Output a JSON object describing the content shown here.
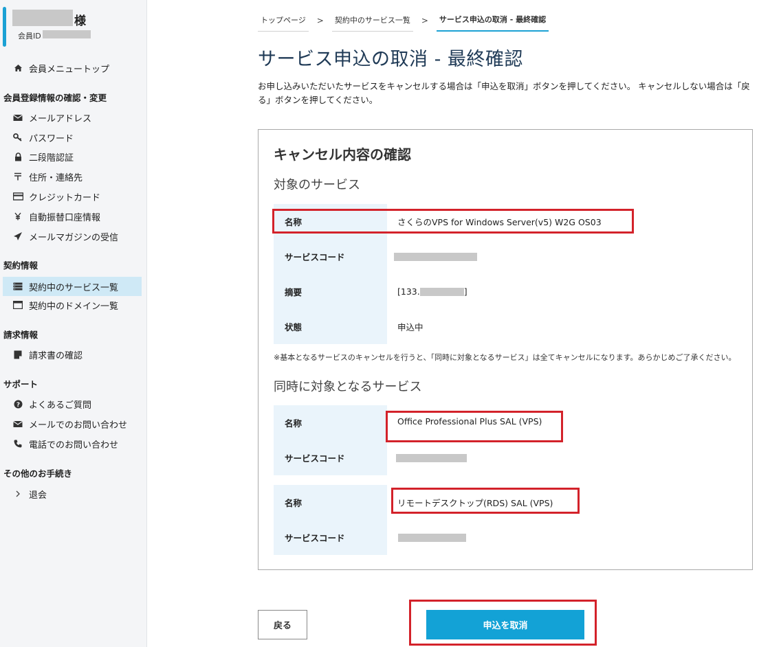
{
  "user": {
    "honorific": "様",
    "member_id_label": "会員ID"
  },
  "sidebar": {
    "top_item": "会員メニュートップ",
    "sections": [
      {
        "heading": "会員登録情報の確認・変更",
        "items": [
          "メールアドレス",
          "パスワード",
          "二段階認証",
          "住所・連絡先",
          "クレジットカード",
          "自動振替口座情報",
          "メールマガジンの受信"
        ]
      },
      {
        "heading": "契約情報",
        "items": [
          "契約中のサービス一覧",
          "契約中のドメイン一覧"
        ]
      },
      {
        "heading": "請求情報",
        "items": [
          "請求書の確認"
        ]
      },
      {
        "heading": "サポート",
        "items": [
          "よくあるご質問",
          "メールでのお問い合わせ",
          "電話でのお問い合わせ"
        ]
      },
      {
        "heading": "その他のお手続き",
        "items": [
          "退会"
        ]
      }
    ],
    "active_item": "契約中のサービス一覧",
    "icons": {
      "top": "home-icon",
      "email": "envelope-icon",
      "password": "key-icon",
      "twofactor": "lock-icon",
      "address": "postal-mark-icon",
      "card": "credit-card-icon",
      "bank": "yen-icon",
      "magazine": "paper-plane-icon"
    }
  },
  "breadcrumb": [
    "トップページ",
    "契約中のサービス一覧",
    "サービス申込の取消 - 最終確認"
  ],
  "breadcrumb_sep": ">",
  "page_title": "サービス申込の取消 - 最終確認",
  "intro": "お申し込みいただいたサービスをキャンセルする場合は「申込を取消」ボタンを押してください。 キャンセルしない場合は「戻る」ボタンを押してください。",
  "panel": {
    "title": "キャンセル内容の確認",
    "target_section_title": "対象のサービス",
    "target_rows": [
      {
        "key": "名称",
        "value": "さくらのVPS for Windows Server(v5) W2G OS03"
      },
      {
        "key": "サービスコード",
        "value": ""
      },
      {
        "key": "摘要",
        "value_prefix": "[133.",
        "value_suffix": "]"
      },
      {
        "key": "状態",
        "value": "申込中"
      }
    ],
    "note": "※基本となるサービスのキャンセルを行うと、「同時に対象となるサービス」は全てキャンセルになります。あらかじめご了承ください。",
    "related_section_title": "同時に対象となるサービス",
    "related_services": [
      {
        "rows": [
          {
            "key": "名称",
            "value": "Office Professional Plus SAL (VPS)"
          },
          {
            "key": "サービスコード",
            "value": ""
          }
        ]
      },
      {
        "rows": [
          {
            "key": "名称",
            "value": "リモートデスクトップ(RDS) SAL (VPS)"
          },
          {
            "key": "サービスコード",
            "value": ""
          }
        ]
      }
    ]
  },
  "buttons": {
    "back": "戻る",
    "cancel": "申込を取消"
  },
  "colors": {
    "accent": "#13a2d6",
    "highlight": "#d3222a",
    "active_nav": "#cfe9f6",
    "key_cell": "#eaf4fb"
  }
}
